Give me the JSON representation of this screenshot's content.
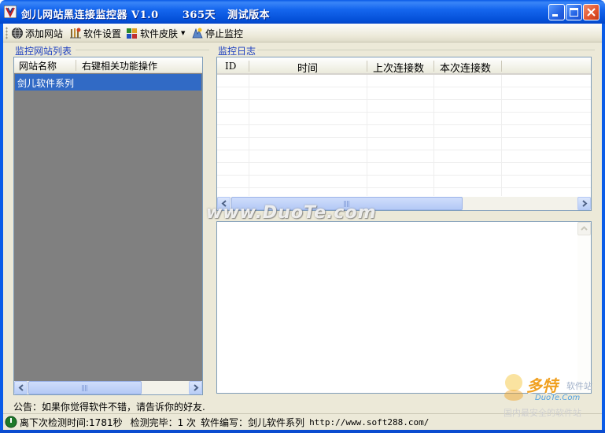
{
  "window": {
    "title": "剑儿网站黑连接监控器 V1.0      365天   测试版本"
  },
  "toolbar": {
    "items": [
      {
        "label": "添加网站",
        "icon": "globe-add-icon"
      },
      {
        "label": "软件设置",
        "icon": "settings-icon"
      },
      {
        "label": "软件皮肤",
        "icon": "skin-icon"
      },
      {
        "label": "停止监控",
        "icon": "stop-monitor-icon"
      }
    ]
  },
  "left_panel": {
    "title": "监控网站列表",
    "columns": [
      "网站名称",
      "右键相关功能操作"
    ],
    "rows": [
      {
        "name": "剑儿软件系列",
        "selected": true
      }
    ],
    "background_color": "#808080",
    "selection_color": "#316ac5"
  },
  "right_panel": {
    "title": "监控日志",
    "columns": [
      "ID",
      "时间",
      "上次连接数",
      "本次连接数"
    ],
    "rows": []
  },
  "notice": "公告：如果你觉得软件不错，请告诉你的好友.",
  "status": {
    "next_check": "离下次检测时间:1781秒",
    "done": "检测完毕：1 次",
    "author": "软件编写：剑儿软件系列",
    "url": "http://www.soft288.com/"
  },
  "watermark": {
    "center": "www.DuoTe.com",
    "brand": "多特",
    "brand_suffix": "软件站",
    "site": "DuoTe.Com",
    "slogan": "国内最安全的软件站"
  },
  "colors": {
    "titlebar": "#0a5ce8",
    "face": "#ece9d8",
    "group_title": "#1c3fc0"
  }
}
